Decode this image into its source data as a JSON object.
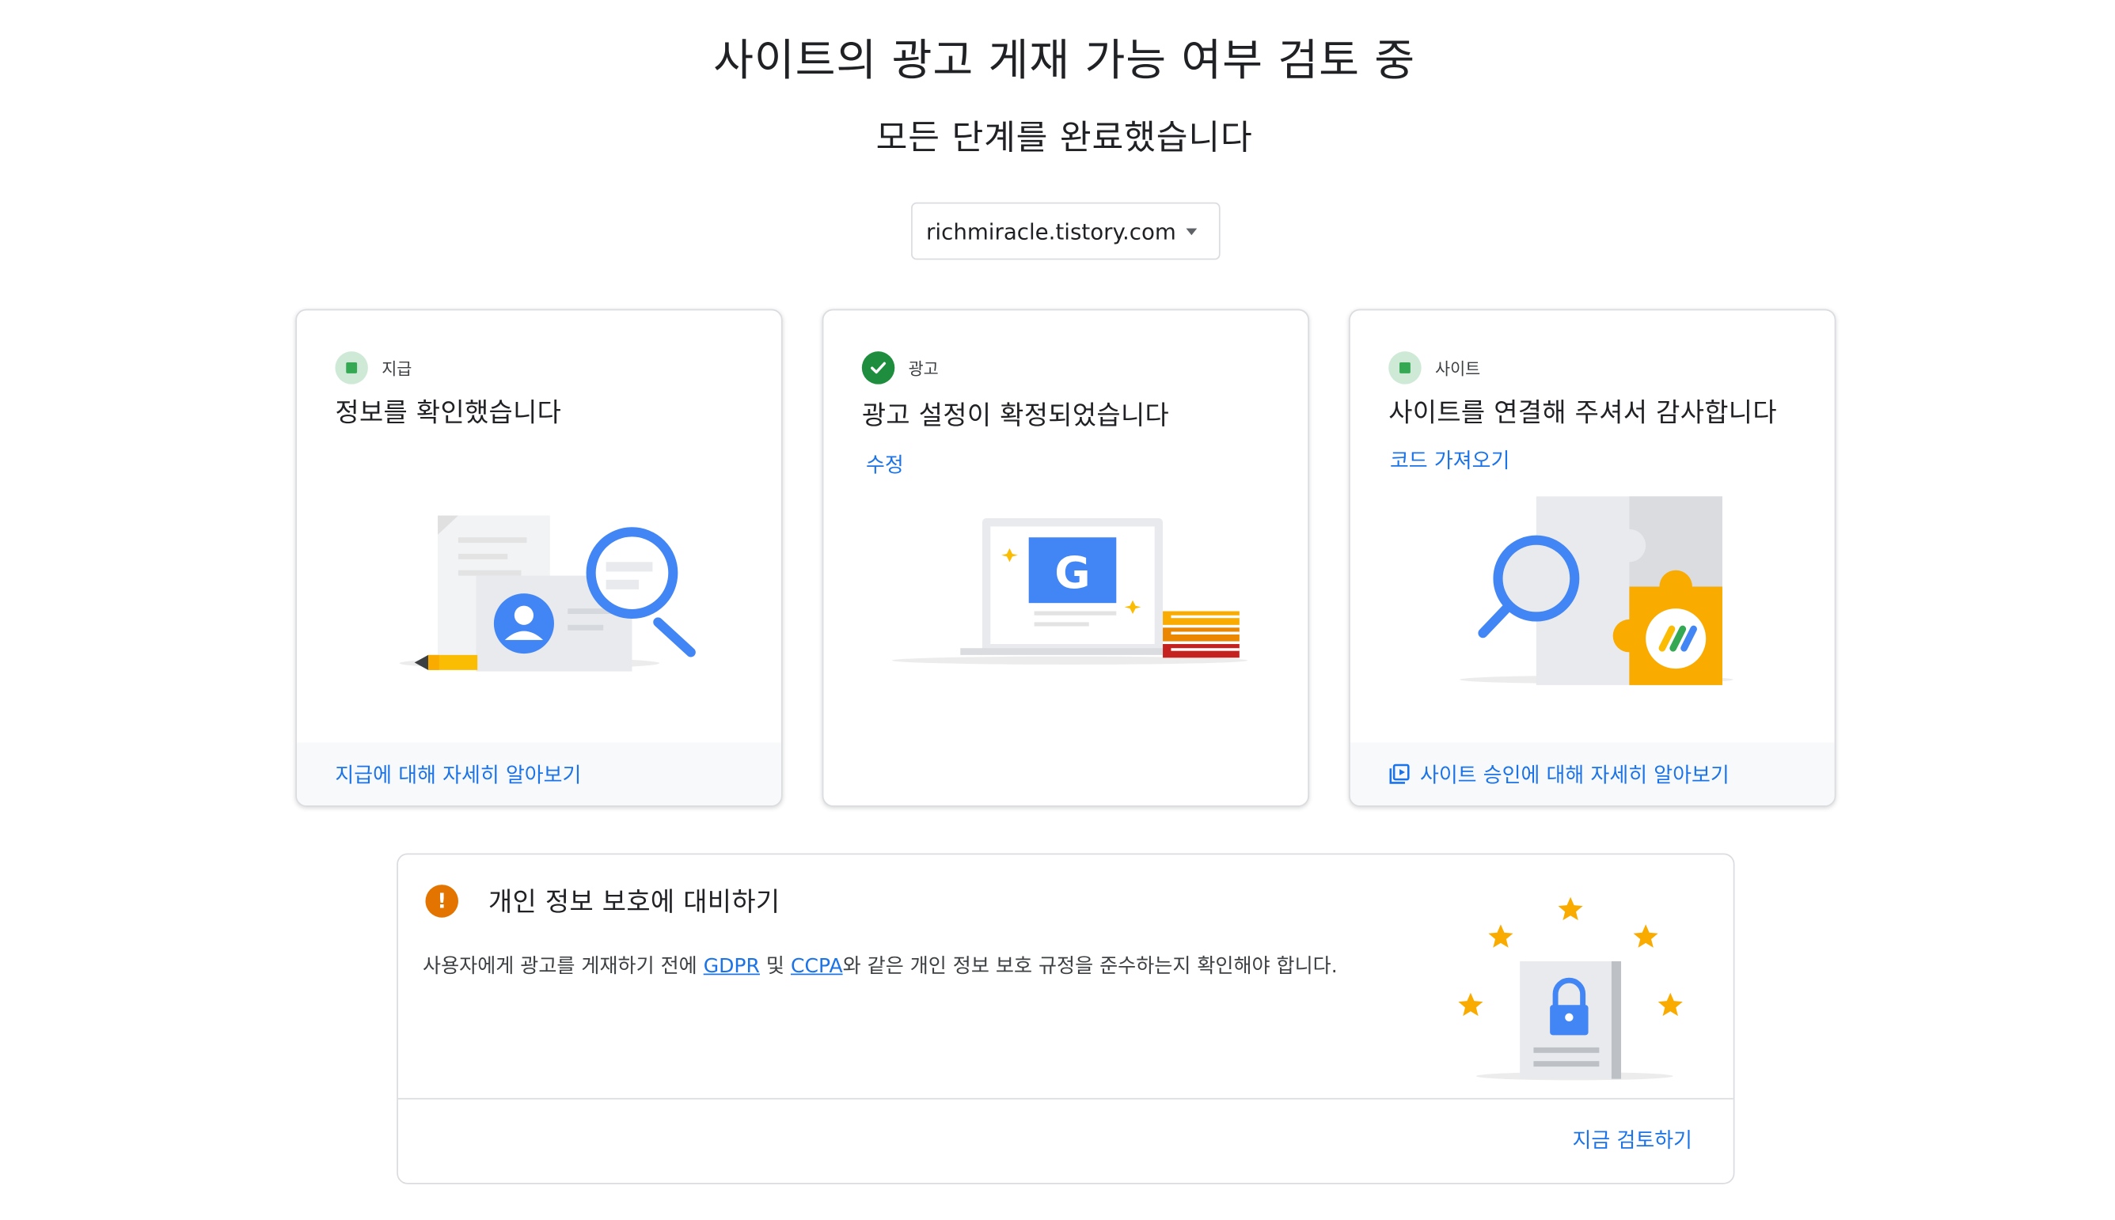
{
  "header": {
    "title": "사이트의 광고 게재 가능 여부 검토 중",
    "subtitle": "모든 단계를 완료했습니다"
  },
  "site_selector": {
    "value": "richmiracle.tistory.com"
  },
  "cards": [
    {
      "label": "지급",
      "status": "in-progress",
      "title": "정보를 확인했습니다",
      "link": "",
      "footer": "지급에 대해 자세히 알아보기"
    },
    {
      "label": "광고",
      "status": "complete",
      "title": "광고 설정이 확정되었습니다",
      "link": "수정",
      "footer": ""
    },
    {
      "label": "사이트",
      "status": "in-progress",
      "title": "사이트를 연결해 주셔서 감사합니다",
      "link": "코드 가져오기",
      "footer": "사이트 승인에 대해 자세히 알아보기"
    }
  ],
  "privacy": {
    "title": "개인 정보 보호에 대비하기",
    "desc_before": "사용자에게 광고를 게재하기 전에 ",
    "link_gdpr": "GDPR",
    "desc_mid": " 및 ",
    "link_ccpa": "CCPA",
    "desc_after": "와 같은 개인 정보 보호 규정을 준수하는지 확인해야 합니다.",
    "action": "지금 검토하기"
  },
  "colors": {
    "link": "#1a73e8",
    "success": "#1e8e3e",
    "warning": "#e37400",
    "google_blue": "#4285f4",
    "star": "#fbbc04"
  }
}
